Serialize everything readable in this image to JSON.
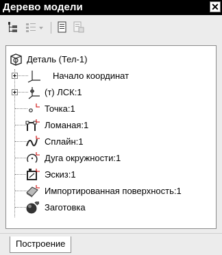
{
  "window": {
    "title": "Дерево модели",
    "close_glyph": "✕"
  },
  "toolbar": {
    "buttons": [
      {
        "icon": "tree-structure-icon",
        "enabled": true
      },
      {
        "icon": "tree-view-dropdown-icon",
        "enabled": false
      },
      {
        "icon": "document-icon",
        "enabled": true
      },
      {
        "icon": "document-properties-icon",
        "enabled": false
      }
    ]
  },
  "tree": {
    "root": {
      "label": "Деталь (Тел-1)",
      "icon": "part-icon"
    },
    "items": [
      {
        "label": "Начало координат",
        "icon": "origin-axes-icon",
        "expandable": true
      },
      {
        "label": "(т) ЛСК:1",
        "icon": "local-coordinate-system-icon",
        "expandable": true
      },
      {
        "label": "Точка:1",
        "icon": "point-icon",
        "expandable": false
      },
      {
        "label": "Ломаная:1",
        "icon": "polyline-icon",
        "expandable": false
      },
      {
        "label": "Сплайн:1",
        "icon": "spline-icon",
        "expandable": false
      },
      {
        "label": "Дуга окружности:1",
        "icon": "circle-arc-icon",
        "expandable": false
      },
      {
        "label": "Эскиз:1",
        "icon": "sketch-icon",
        "expandable": false
      },
      {
        "label": "Импортированная поверхность:1",
        "icon": "imported-surface-icon",
        "expandable": false
      },
      {
        "label": "Заготовка",
        "icon": "blank-body-icon",
        "expandable": false
      }
    ]
  },
  "tabs": [
    {
      "label": "Построение",
      "active": true
    }
  ],
  "colors": {
    "titlebar": "#000000",
    "panel": "#ececec",
    "tree_background": "#ffffff",
    "icon_red": "#cc0000"
  }
}
